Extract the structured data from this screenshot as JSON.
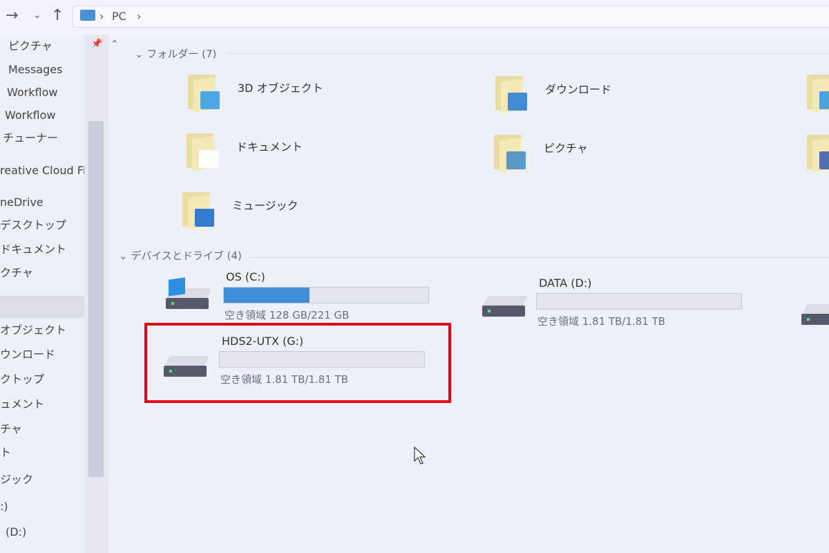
{
  "nav": {
    "back": "←",
    "forward": "→",
    "dropdown": "⌄",
    "up": "↑",
    "path": [
      "PC"
    ]
  },
  "sidebar": {
    "items": [
      "ピクチャ",
      "Messages",
      "Workflow",
      "Workflow",
      "チューナー",
      "reative Cloud File",
      "neDrive",
      "デスクトップ",
      "ドキュメント",
      "クチャ",
      "",
      "オブジェクト",
      "ウンロード",
      "クトップ",
      "ュメント",
      "チャ",
      "ト",
      "ジック",
      ":)",
      "(D:)"
    ]
  },
  "folders": {
    "header": "フォルダー (7)",
    "items": [
      {
        "name": "3D オブジェクト",
        "icon": "3d-objects"
      },
      {
        "name": "ダウンロード",
        "icon": "download"
      },
      {
        "name": "",
        "icon": "desktop"
      },
      {
        "name": "ドキュメント",
        "icon": "documents"
      },
      {
        "name": "ピクチャ",
        "icon": "pictures"
      },
      {
        "name": "",
        "icon": "videos"
      },
      {
        "name": "ミュージック",
        "icon": "music"
      }
    ]
  },
  "drives": {
    "header": "デバイスとドライブ (4)",
    "items": [
      {
        "name": "OS (C:)",
        "free": "空き領域 128 GB/221 GB",
        "used_percent": 42
      },
      {
        "name": "DATA (D:)",
        "free": "空き領域 1.81 TB/1.81 TB",
        "used_percent": 0
      },
      {
        "name": "HDS2-UTX (G:)",
        "free": "空き領域 1.81 TB/1.81 TB",
        "used_percent": 0,
        "highlighted": true
      }
    ]
  },
  "colors": {
    "accent": "#3f8fd8",
    "highlight": "#e3001b"
  }
}
